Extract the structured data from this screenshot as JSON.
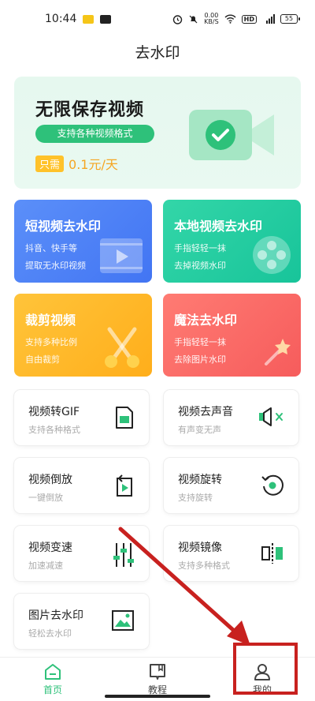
{
  "status_bar": {
    "time": "10:44",
    "net_speed_value": "0.00",
    "net_speed_unit": "KB/S",
    "hd_label": "HD",
    "signal_label": "4G",
    "battery": "55"
  },
  "header": {
    "title": "去水印"
  },
  "banner": {
    "title": "无限保存视频",
    "pill": "支持各种视频格式",
    "price_badge": "只需",
    "price_text": "0.1元/天"
  },
  "feature_cards": [
    {
      "title": "短视频去水印",
      "line1": "抖音、快手等",
      "line2": "提取无水印视频"
    },
    {
      "title": "本地视频去水印",
      "line1": "手指轻轻一抹",
      "line2": "去掉视频水印"
    },
    {
      "title": "裁剪视频",
      "line1": "支持多种比例",
      "line2": "自由裁剪"
    },
    {
      "title": "魔法去水印",
      "line1": "手指轻轻一抹",
      "line2": "去除图片水印"
    }
  ],
  "tools": [
    {
      "title": "视频转GIF",
      "sub": "支持各种格式",
      "icon": "gif-icon"
    },
    {
      "title": "视频去声音",
      "sub": "有声变无声",
      "icon": "mute-icon"
    },
    {
      "title": "视频倒放",
      "sub": "一键倒放",
      "icon": "reverse-icon"
    },
    {
      "title": "视频旋转",
      "sub": "支持旋转",
      "icon": "rotate-icon"
    },
    {
      "title": "视频变速",
      "sub": "加速减速",
      "icon": "speed-icon"
    },
    {
      "title": "视频镜像",
      "sub": "支持多种格式",
      "icon": "mirror-icon"
    },
    {
      "title": "图片去水印",
      "sub": "轻松去水印",
      "icon": "image-icon"
    }
  ],
  "bottom_nav": [
    {
      "label": "首页",
      "icon": "home-icon",
      "active": true
    },
    {
      "label": "教程",
      "icon": "book-icon",
      "active": false
    },
    {
      "label": "我的",
      "icon": "user-icon",
      "active": false
    }
  ],
  "colors": {
    "accent_green": "#2ec17a",
    "annotation_red": "#c8211f",
    "card_blue": "#4d82f5",
    "card_teal": "#22cda0",
    "card_orange": "#ffb82a",
    "card_red": "#f86a66"
  }
}
